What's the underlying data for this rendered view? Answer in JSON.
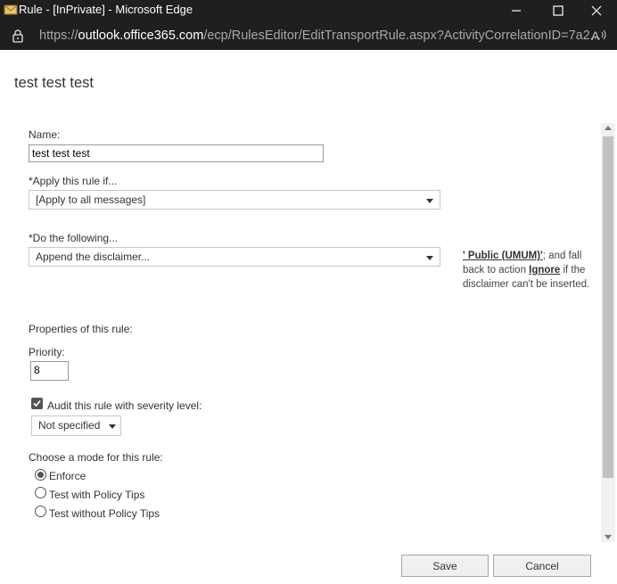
{
  "window": {
    "title": "Rule - [InPrivate] - Microsoft Edge",
    "url_prefix": "https://",
    "url_host": "outlook.office365.com",
    "url_path": "/ecp/RulesEditor/EditTransportRule.aspx?ActivityCorrelationID=7a2..."
  },
  "page": {
    "title": "test test test"
  },
  "form": {
    "name_label": "Name:",
    "name_value": "test test test",
    "apply_label": "*Apply this rule if...",
    "apply_value": "[Apply to all messages]",
    "do_label": "*Do the following...",
    "do_value": "Append the disclaimer...",
    "action_desc": {
      "link_public": "' Public (UMUM)'",
      "text_1": "; and fall back to action ",
      "link_ignore": "Ignore",
      "text_2": " if the disclaimer can't be inserted."
    },
    "properties_label": "Properties of this rule:",
    "priority_label": "Priority:",
    "priority_value": "8",
    "audit_label": "Audit this rule with severity level:",
    "audit_checked": true,
    "severity_value": "Not specified",
    "mode_label": "Choose a mode for this rule:",
    "modes": [
      {
        "label": "Enforce",
        "selected": true
      },
      {
        "label": "Test with Policy Tips",
        "selected": false
      },
      {
        "label": "Test without Policy Tips",
        "selected": false
      }
    ]
  },
  "buttons": {
    "save": "Save",
    "cancel": "Cancel"
  },
  "icons": {
    "app": "outlook-app-icon",
    "minimize": "minimize-icon",
    "maximize": "maximize-icon",
    "close": "close-icon",
    "lock": "lock-icon",
    "read_aloud": "read-aloud-icon"
  },
  "colors": {
    "titlebar": "#1f1f1f",
    "text": "#333333"
  }
}
